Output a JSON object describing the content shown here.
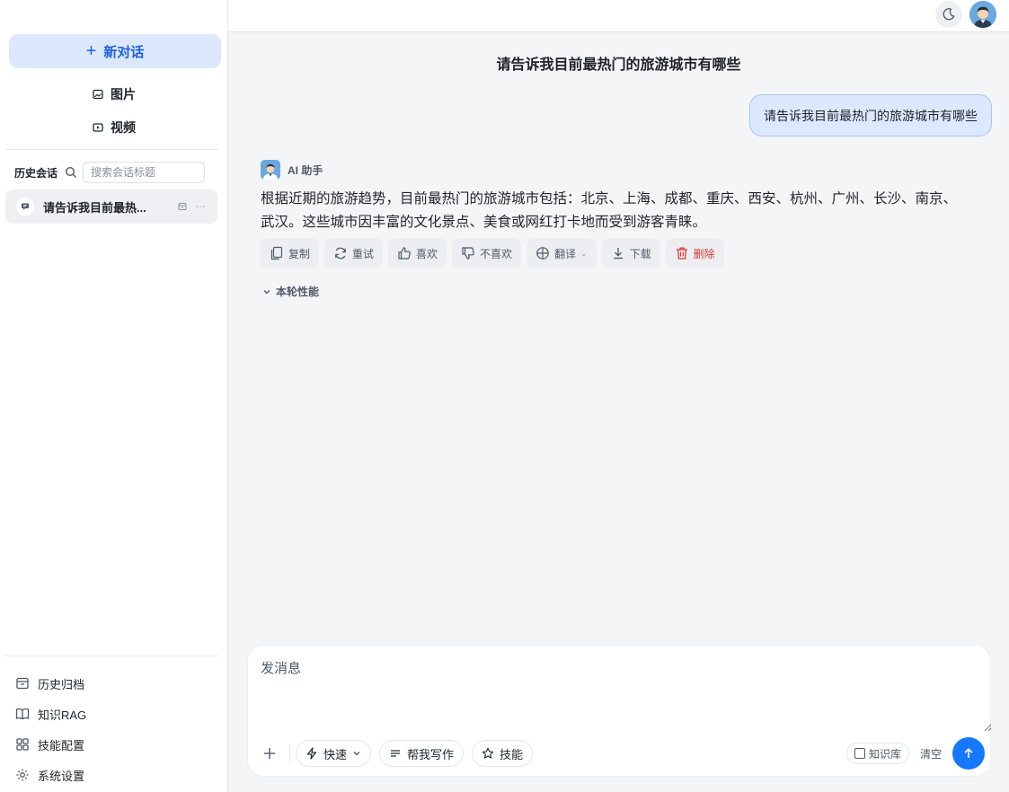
{
  "sidebar": {
    "new_chat_label": "新对话",
    "nav": [
      {
        "label": "图片",
        "icon": "image-icon"
      },
      {
        "label": "视频",
        "icon": "video-icon"
      }
    ],
    "history_title": "历史会话",
    "search_placeholder": "搜索会话标题",
    "conversations": [
      {
        "title": "请告诉我目前最热..."
      }
    ],
    "bottom": [
      {
        "label": "历史归档",
        "icon": "archive-icon"
      },
      {
        "label": "知识RAG",
        "icon": "book-icon"
      },
      {
        "label": "技能配置",
        "icon": "grid-icon"
      },
      {
        "label": "系统设置",
        "icon": "settings-icon"
      }
    ]
  },
  "chat": {
    "title": "请告诉我目前最热门的旅游城市有哪些",
    "user_message": "请告诉我目前最热门的旅游城市有哪些",
    "ai_name": "AI 助手",
    "ai_message": "根据近期的旅游趋势，目前最热门的旅游城市包括：北京、上海、成都、重庆、西安、杭州、广州、长沙、南京、武汉。这些城市因丰富的文化景点、美食或网红打卡地而受到游客青睐。",
    "actions": {
      "copy": "复制",
      "retry": "重试",
      "like": "喜欢",
      "dislike": "不喜欢",
      "translate": "翻译",
      "download": "下载",
      "delete": "删除"
    },
    "perf_label": "本轮性能"
  },
  "composer": {
    "placeholder": "发消息",
    "mode_label": "快速",
    "write_label": "帮我写作",
    "skills_label": "技能",
    "knowledge_label": "知识库",
    "clear_label": "清空"
  },
  "colors": {
    "accent": "#1677ff",
    "new_chat_bg": "#dce8fd",
    "danger": "#e03a2f"
  }
}
